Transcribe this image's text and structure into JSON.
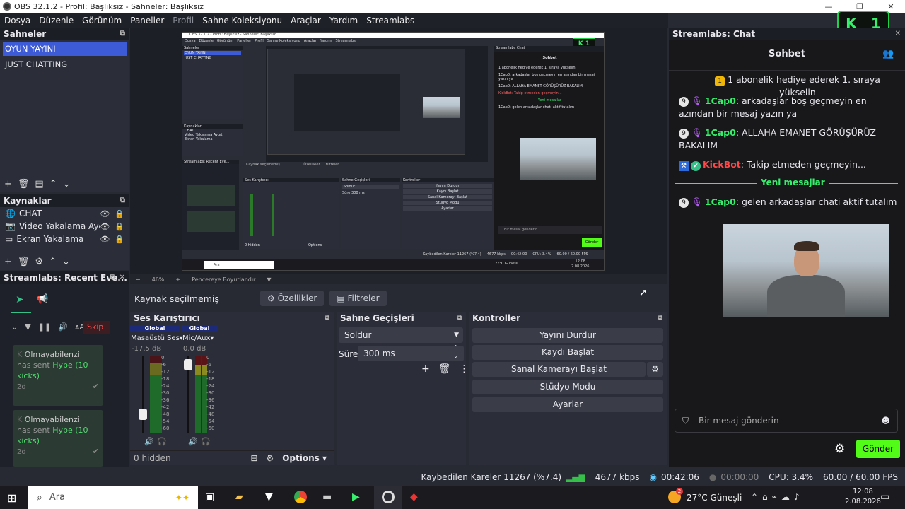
{
  "window": {
    "title": "OBS 32.1.2 - Profil: Başlıksız - Sahneler: Başlıksız"
  },
  "menu": [
    "Dosya",
    "Düzenle",
    "Görünüm",
    "Paneller",
    "Profil",
    "Sahne Koleksiyonu",
    "Araçlar",
    "Yardım",
    "Streamlabs"
  ],
  "kick_widget": {
    "count": "1"
  },
  "scenes": {
    "header": "Sahneler",
    "items": [
      "OYUN YAYINI",
      "JUST CHATTING"
    ]
  },
  "sources": {
    "header": "Kaynaklar",
    "items": [
      "CHAT",
      "Video Yakalama Aygıt",
      "Ekran Yakalama"
    ]
  },
  "events": {
    "header": "Streamlabs: Recent Eve...",
    "skip_label": "Skip A",
    "items": [
      {
        "user": "Olmayabilenzi",
        "text1": "has sent",
        "hype": "Hype",
        "amount": "(10",
        "amount2": "kicks)",
        "time": "2d"
      },
      {
        "user": "Olmayabilenzi",
        "text1": "has sent",
        "hype": "Hype",
        "amount": "(10",
        "amount2": "kicks)",
        "time": "2d"
      }
    ]
  },
  "preview": {
    "zoom": "46%",
    "resize_label": "Pencereye Boyutlandır",
    "mini": {
      "scenes_header": "Sahneler",
      "scene_items": [
        "OYUN YAYINI",
        "JUST CHATTING"
      ],
      "sources_header": "Kaynaklar",
      "source_items": [
        "CHAT",
        "Video Yakalama Aygıt",
        "Ekran Yakalama"
      ],
      "events_header": "Streamlabs: Recent Eve...",
      "no_source": "Kaynak seçilmemiş",
      "props": "Özellikler",
      "filters": "Filtreler",
      "mixer_header": "Ses Karıştırıcı",
      "trans_header": "Sahne Geçişleri",
      "controls_header": "Kontroller",
      "controls": [
        "Yayını Durdur",
        "Kaydı Başlat",
        "Sanal Kamerayı Başlat",
        "Stüdyo Modu",
        "Ayarlar"
      ],
      "transition": "Soldur",
      "duration_label": "Süre",
      "duration": "300 ms",
      "chat_header": "Streamlabs Chat",
      "chat_title": "Sohbet",
      "chat_lines": [
        "1 abonelik hediye ederek 1. sıraya yükselin",
        "1Cap0: arkadaşlar boş geçmeyin en azından bir mesaj yazın ya",
        "1Cap0: ALLAHA EMANET GÖRÜŞÜRÜZ BAKALIM",
        "KickBot: Takip etmeden geçmeyin..."
      ],
      "new_messages": "Yeni mesajlar",
      "last_line": "1Cap0: gelen arkadaşlar chati aktif tutalım",
      "input_placeholder": "Bir mesaj gönderin",
      "send": "Gönder",
      "hidden": "0 hidden",
      "options": "Options",
      "search": "Ara",
      "status": "Kaybedilen Kareler 11267 (%7.4)",
      "kbps": "4677 kbps",
      "time": "00:42:00",
      "cpu": "CPU: 3.4%",
      "fps": "60.00 / 60.00 FPS",
      "weather": "27°C Güneşli",
      "clock": "12:08",
      "date": "2.08.2026"
    }
  },
  "context": {
    "no_source": "Kaynak seçilmemiş",
    "properties": "Özellikler",
    "filters": "Filtreler"
  },
  "mixer": {
    "header": "Ses Karıştırıcı",
    "channels": [
      {
        "tag": "Global",
        "name": "Masaüstü Ses",
        "db": "-17.5 dB",
        "level": 0.2
      },
      {
        "tag": "Global",
        "name": "Mic/Aux",
        "db": "0.0 dB",
        "level": 0.95
      }
    ],
    "scale": [
      "0",
      "-6",
      "-12",
      "-18",
      "-24",
      "-30",
      "-36",
      "-42",
      "-48",
      "-54",
      "-60"
    ],
    "hidden": "0 hidden",
    "options": "Options"
  },
  "transitions": {
    "header": "Sahne Geçişleri",
    "selected": "Soldur",
    "duration_label": "Süre",
    "duration": "300 ms"
  },
  "controls": {
    "header": "Kontroller",
    "buttons": [
      "Yayını Durdur",
      "Kaydı Başlat",
      "Sanal Kamerayı Başlat",
      "Stüdyo Modu",
      "Ayarlar"
    ]
  },
  "chat": {
    "dock_header": "Streamlabs: Chat",
    "title": "Sohbet",
    "gift": "1 abonelik hediye ederek 1. sıraya yükselin",
    "messages": [
      {
        "badge": "9",
        "user": "1Cap0",
        "text": "arkadaşlar boş geçmeyin en azından bir mesaj yazın ya"
      },
      {
        "badge": "9",
        "user": "1Cap0",
        "text": "ALLAHA EMANET GÖRÜŞÜRÜZ BAKALIM"
      }
    ],
    "bot": {
      "user": "KickBot",
      "text": "Takip etmeden geçmeyin..."
    },
    "new_messages": "Yeni mesajlar",
    "last": {
      "badge": "9",
      "user": "1Cap0",
      "text": "gelen arkadaşlar chati aktif tutalım"
    },
    "input_placeholder": "Bir mesaj gönderin",
    "send": "Gönder"
  },
  "status": {
    "dropped": "Kaybedilen Kareler 11267 (%7.4)",
    "kbps": "4677 kbps",
    "stream_time": "00:42:06",
    "rec_time": "00:00:00",
    "cpu": "CPU: 3.4%",
    "fps": "60.00 / 60.00 FPS"
  },
  "taskbar": {
    "search": "Ara",
    "weather": "27°C Güneşli",
    "weather_badge": "2",
    "time": "12:08",
    "date": "2.08.2026"
  },
  "colors": {
    "accent": "#3d5bd6",
    "kick_green": "#35f06a",
    "send_green": "#53fc18"
  }
}
